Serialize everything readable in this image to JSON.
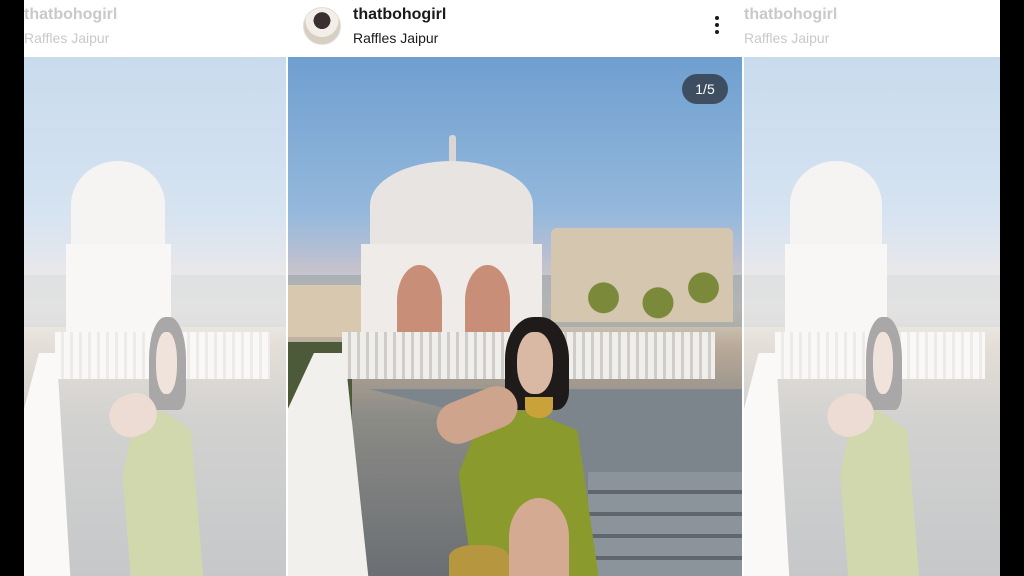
{
  "post": {
    "username": "thatbohogirl",
    "location": "Raffles Jaipur",
    "carousel_counter": "1/5",
    "more_icon": "more-vertical-icon",
    "avatar_icon": "profile-avatar"
  },
  "prev_post": {
    "username": "thatbohogirl",
    "location": "Raffles Jaipur"
  },
  "next_post": {
    "username": "thatbohogirl",
    "location": "Raffles Jaipur"
  },
  "colors": {
    "page_background": "#000000",
    "card_background": "#ffffff",
    "text": "#1a1a1a",
    "faded_text": "#c9c9c9",
    "counter_badge": "#282c34"
  }
}
